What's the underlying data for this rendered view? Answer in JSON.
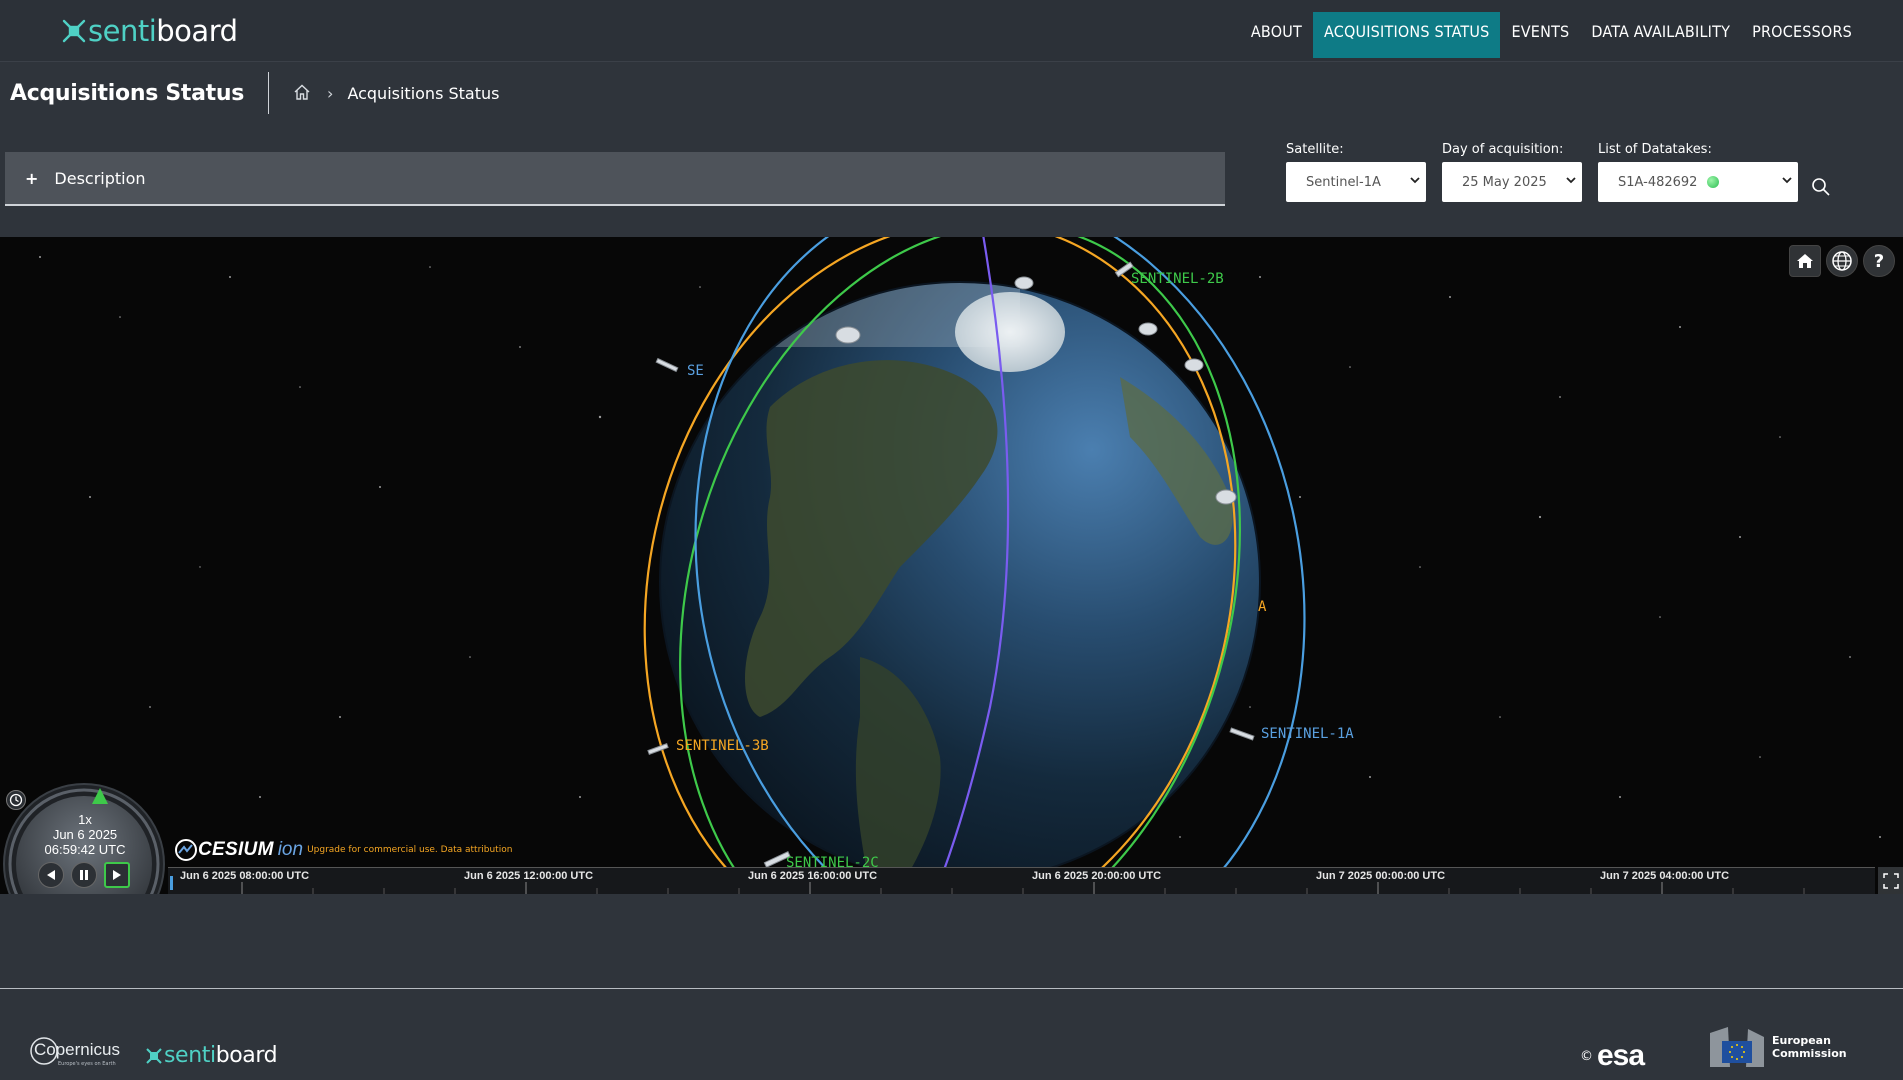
{
  "app": {
    "logo_part1": "senti",
    "logo_part2": "board"
  },
  "nav": {
    "items": [
      {
        "label": "ABOUT",
        "active": false
      },
      {
        "label": "ACQUISITIONS STATUS",
        "active": true
      },
      {
        "label": "EVENTS",
        "active": false
      },
      {
        "label": "DATA AVAILABILITY",
        "active": false
      },
      {
        "label": "PROCESSORS",
        "active": false
      }
    ],
    "active_color": "#0e7b86"
  },
  "page": {
    "title": "Acquisitions Status",
    "breadcrumb_home_icon": "home-icon",
    "breadcrumb_current": "Acquisitions Status"
  },
  "description": {
    "toggle_symbol": "+",
    "label": "Description"
  },
  "filters": {
    "satellite": {
      "label": "Satellite:",
      "value": "Sentinel-1A"
    },
    "day": {
      "label": "Day of acquisition:",
      "value": "25 May 2025"
    },
    "datatakes": {
      "label": "List of Datatakes:",
      "value": "S1A-482692",
      "status_color": "#2dbd52"
    },
    "search_icon": "search-icon"
  },
  "viewer": {
    "toolbar": {
      "home_icon": "home-icon",
      "globe_icon": "globe-icon",
      "help_symbol": "?"
    },
    "satellites": [
      {
        "label": "SENTINEL-2B",
        "color": "#3ec94a"
      },
      {
        "label": "SE",
        "color": "#5aa0e0"
      },
      {
        "label": "A",
        "color": "#f5a623"
      },
      {
        "label": "SENTINEL-1A",
        "color": "#5aa0e0"
      },
      {
        "label": "SENTINEL-3B",
        "color": "#f5a623"
      },
      {
        "label": "SENTINEL-2C",
        "color": "#3ec94a"
      }
    ],
    "cesium": {
      "brand": "CESIUM",
      "ion": "ion",
      "credit": "Upgrade for commercial use. Data attribution"
    },
    "clock": {
      "speed": "1x",
      "date": "Jun 6 2025",
      "time": "06:59:42 UTC"
    },
    "timeline_labels": [
      "Jun 6 2025 08:00:00 UTC",
      "Jun 6 2025 12:00:00 UTC",
      "Jun 6 2025 16:00:00 UTC",
      "Jun 6 2025 20:00:00 UTC",
      "Jun 7 2025 00:00:00 UTC",
      "Jun 7 2025 04:00:00 UTC"
    ]
  },
  "footer": {
    "copernicus_logo": "Copernicus",
    "copernicus_tagline": "Europe's eyes on Earth",
    "sentiboard_part1": "senti",
    "sentiboard_part2": "board",
    "esa_copyright": "©",
    "esa_logo": "esa",
    "ec_line1": "European",
    "ec_line2": "Commission"
  }
}
